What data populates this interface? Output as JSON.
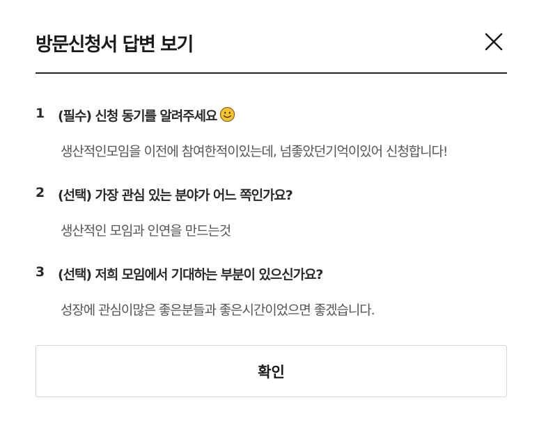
{
  "modal": {
    "title": "방문신청서 답변 보기"
  },
  "questions": [
    {
      "number": "1",
      "question": "(필수) 신청 동기를 알려주세요",
      "emoji_icon": "smiling-face-icon",
      "answer": "생산적인모임을 이전에 참여한적이있는데, 넘좋았던기억이있어 신청합니다!"
    },
    {
      "number": "2",
      "question": "(선택) 가장 관심 있는 분야가 어느 쪽인가요?",
      "answer": "생산적인 모임과 인연을 만드는것"
    },
    {
      "number": "3",
      "question": "(선택) 저희 모임에서 기대하는 부분이 있으신가요?",
      "answer": "성장에 관심이많은 좋은분들과 좋은시간이었으면 좋겠습니다."
    }
  ],
  "footer": {
    "confirm_label": "확인"
  },
  "colors": {
    "text_primary": "#1a1a1a",
    "text_answer": "#555555",
    "divider": "#222222",
    "button_border": "#d6d6d6"
  }
}
